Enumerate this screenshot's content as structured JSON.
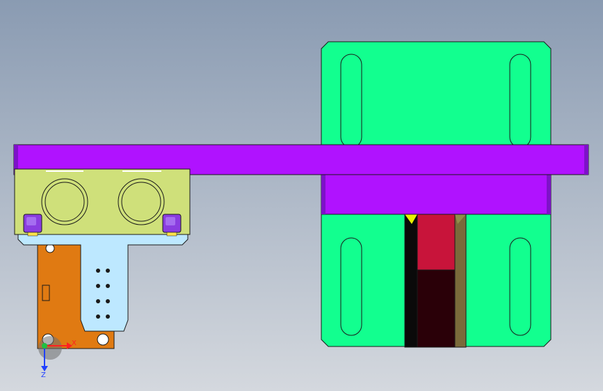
{
  "viewport": {
    "background_top": "#8a9bb2",
    "background_bottom": "#d4d8de"
  },
  "colors": {
    "outline": "#1a1a1a",
    "green_plate": "#12ff8f",
    "purple_bar": "#b012ff",
    "purple_dark": "#7d12c8",
    "yellow_block": "#cfe07a",
    "light_blue_bracket": "#bde8ff",
    "orange_plate": "#e07a12",
    "violet_screw": "#8a3de0",
    "red_block": "#c8143a",
    "dark_maroon": "#2a0008",
    "olive_strip": "#7a6a3a",
    "black_strip": "#0a0a0a",
    "yellow_triangle": "#e8f000",
    "axis_x": "#ff2020",
    "axis_z": "#2040ff",
    "axis_origin": "#20c040"
  },
  "triad": {
    "x_label": "X",
    "z_label": "Z"
  }
}
